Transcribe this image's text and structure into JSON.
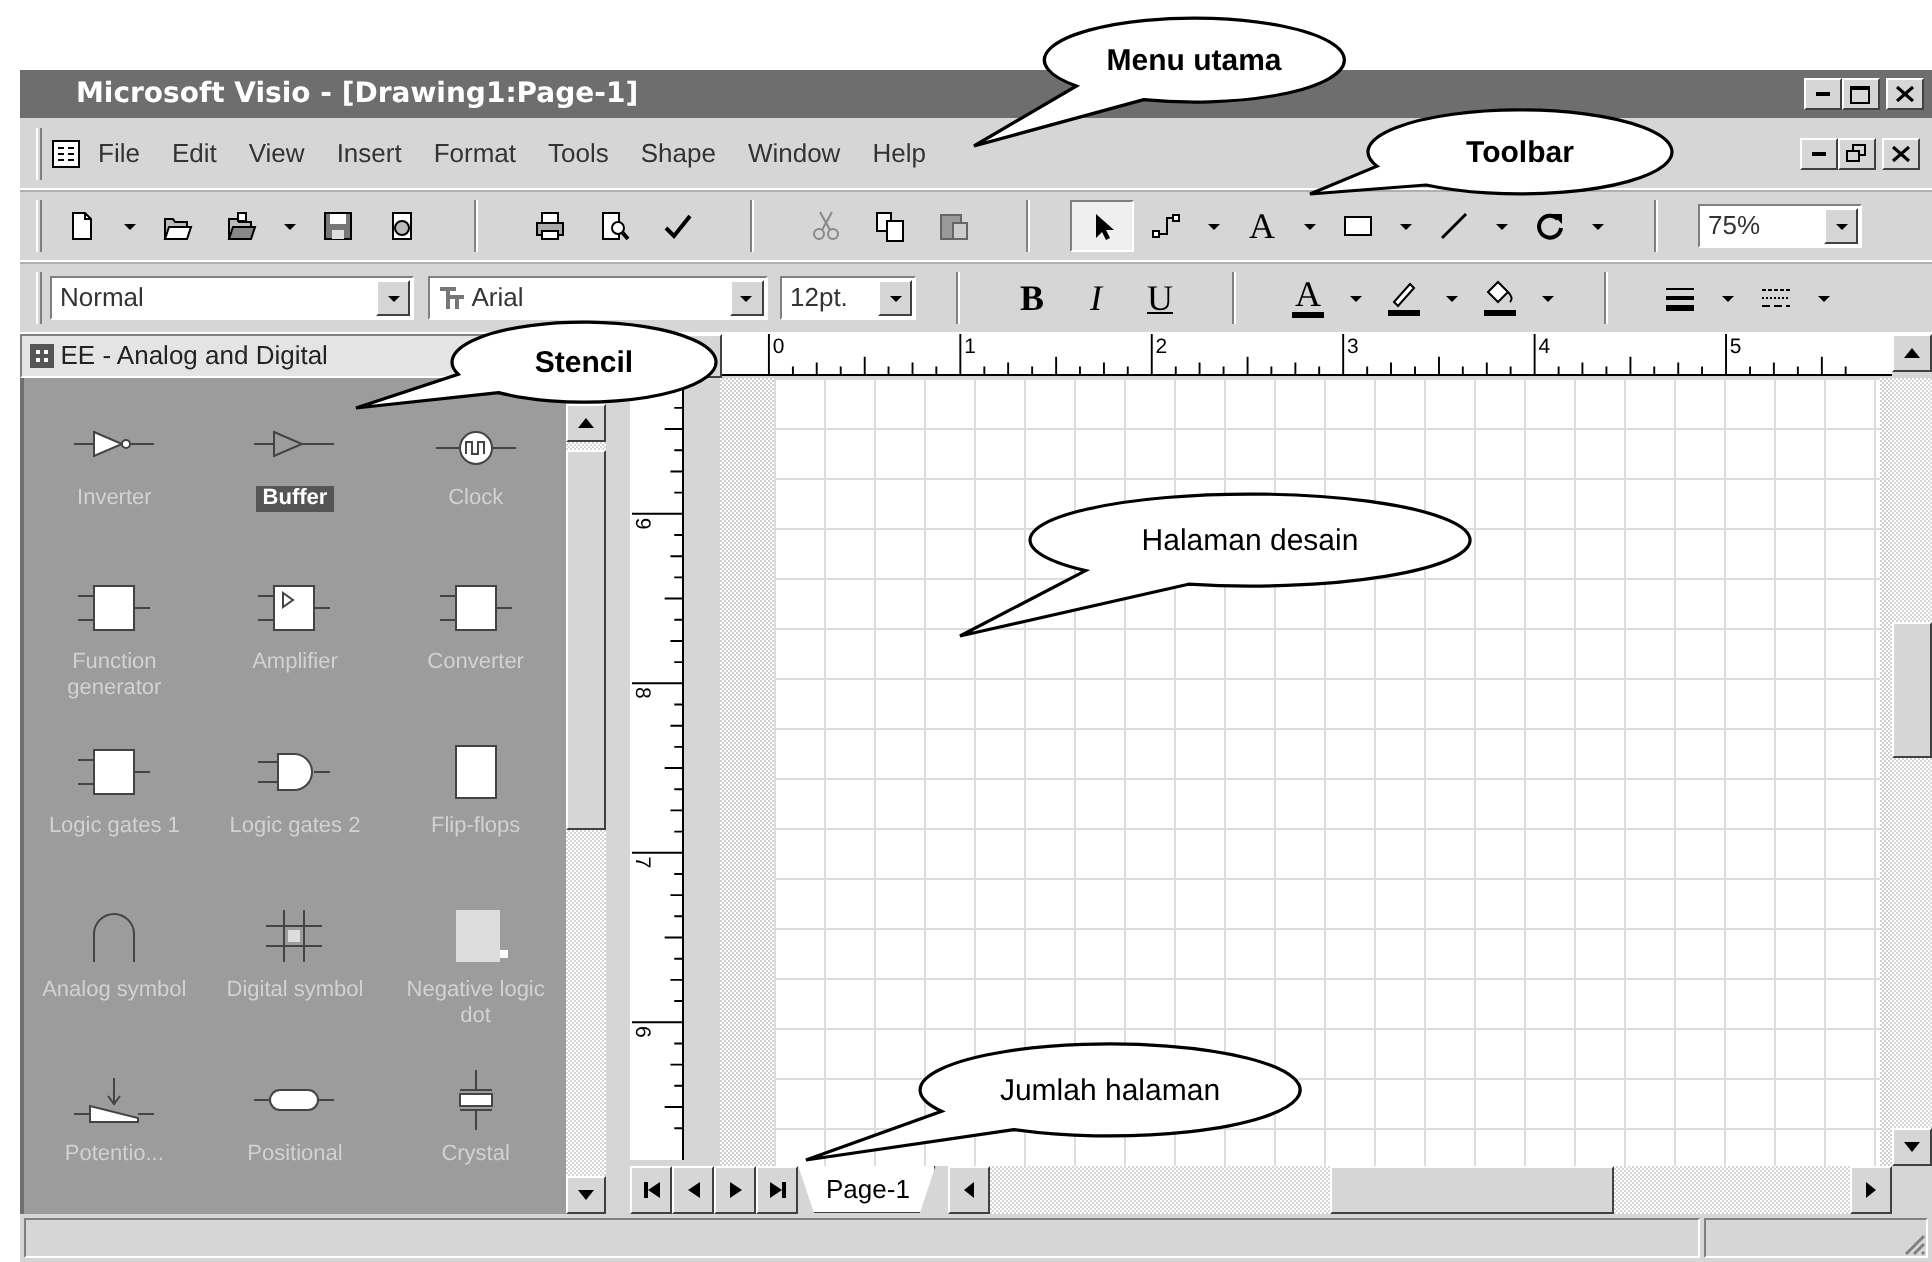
{
  "window": {
    "title": "Microsoft Visio - [Drawing1:Page-1]"
  },
  "menu": [
    "File",
    "Edit",
    "View",
    "Insert",
    "Format",
    "Tools",
    "Shape",
    "Window",
    "Help"
  ],
  "standard_toolbar": {
    "groups": [
      [
        {
          "kind": "new",
          "dropdown": true,
          "selected": false
        },
        {
          "kind": "open",
          "dropdown": false,
          "selected": false
        },
        {
          "kind": "open-stencil",
          "dropdown": true,
          "selected": false
        },
        {
          "kind": "save",
          "dropdown": false,
          "selected": false
        },
        {
          "kind": "publish",
          "dropdown": false,
          "selected": false
        }
      ],
      [
        {
          "kind": "print",
          "dropdown": false,
          "selected": false
        },
        {
          "kind": "print-preview",
          "dropdown": false,
          "selected": false
        },
        {
          "kind": "spelling",
          "dropdown": false,
          "selected": false
        }
      ],
      [
        {
          "kind": "cut",
          "dropdown": false,
          "selected": false
        },
        {
          "kind": "copy",
          "dropdown": false,
          "selected": false
        },
        {
          "kind": "paste",
          "dropdown": false,
          "selected": false
        }
      ],
      [
        {
          "kind": "pointer",
          "dropdown": false,
          "selected": true
        },
        {
          "kind": "connector",
          "dropdown": true,
          "selected": false
        },
        {
          "kind": "text",
          "glyph": "A",
          "dropdown": true,
          "selected": false
        },
        {
          "kind": "rectangle",
          "dropdown": true,
          "selected": false
        },
        {
          "kind": "line",
          "dropdown": true,
          "selected": false
        },
        {
          "kind": "rotate",
          "dropdown": true,
          "selected": false
        }
      ]
    ],
    "zoom": "75%"
  },
  "formatting_toolbar": {
    "style": "Normal",
    "font": "Arial",
    "size": "12pt.",
    "groups": [
      [
        {
          "kind": "bold",
          "glyph": "B",
          "dropdown": false
        },
        {
          "kind": "italic",
          "glyph": "I",
          "dropdown": false
        },
        {
          "kind": "underline",
          "glyph": "U",
          "dropdown": false
        }
      ],
      [
        {
          "kind": "font-color",
          "glyph": "A",
          "dropdown": true
        },
        {
          "kind": "line-color",
          "dropdown": true
        },
        {
          "kind": "fill-color",
          "dropdown": true
        }
      ],
      [
        {
          "kind": "line-weight",
          "dropdown": true
        },
        {
          "kind": "line-pattern",
          "dropdown": true
        }
      ]
    ]
  },
  "stencil": {
    "title": "EE - Analog and Digital",
    "shapes": [
      {
        "label": "Inverter",
        "kind": "inverter",
        "selected": false
      },
      {
        "label": "Buffer",
        "kind": "buffer",
        "selected": true
      },
      {
        "label": "Clock",
        "kind": "clock",
        "selected": false
      },
      {
        "label": "Function generator",
        "kind": "function-generator",
        "selected": false
      },
      {
        "label": "Amplifier",
        "kind": "amplifier",
        "selected": false
      },
      {
        "label": "Converter",
        "kind": "converter",
        "selected": false
      },
      {
        "label": "Logic gates 1",
        "kind": "logic-gates-1",
        "selected": false
      },
      {
        "label": "Logic gates 2",
        "kind": "logic-gates-2",
        "selected": false
      },
      {
        "label": "Flip-flops",
        "kind": "flip-flops",
        "selected": false
      },
      {
        "label": "Analog symbol",
        "kind": "analog-symbol",
        "selected": false
      },
      {
        "label": "Digital symbol",
        "kind": "digital-symbol",
        "selected": false
      },
      {
        "label": "Negative logic dot",
        "kind": "negative-logic-dot",
        "selected": false
      },
      {
        "label": "Potentio...",
        "kind": "potentiometer",
        "selected": false
      },
      {
        "label": "Positional",
        "kind": "positional",
        "selected": false
      },
      {
        "label": "Crystal",
        "kind": "crystal",
        "selected": false
      }
    ]
  },
  "rulers": {
    "horizontal": [
      "0",
      "1",
      "2",
      "3",
      "4",
      "5"
    ],
    "vertical": [
      "9",
      "8",
      "7",
      "6"
    ]
  },
  "page_tabs": [
    {
      "label": "Page-1",
      "selected": true
    }
  ],
  "callouts": [
    {
      "text": "Menu utama",
      "bold": true
    },
    {
      "text": "Toolbar",
      "bold": true
    },
    {
      "text": "Stencil",
      "bold": true
    },
    {
      "text": "Halaman desain",
      "bold": false
    },
    {
      "text": "Jumlah halaman",
      "bold": false
    }
  ]
}
